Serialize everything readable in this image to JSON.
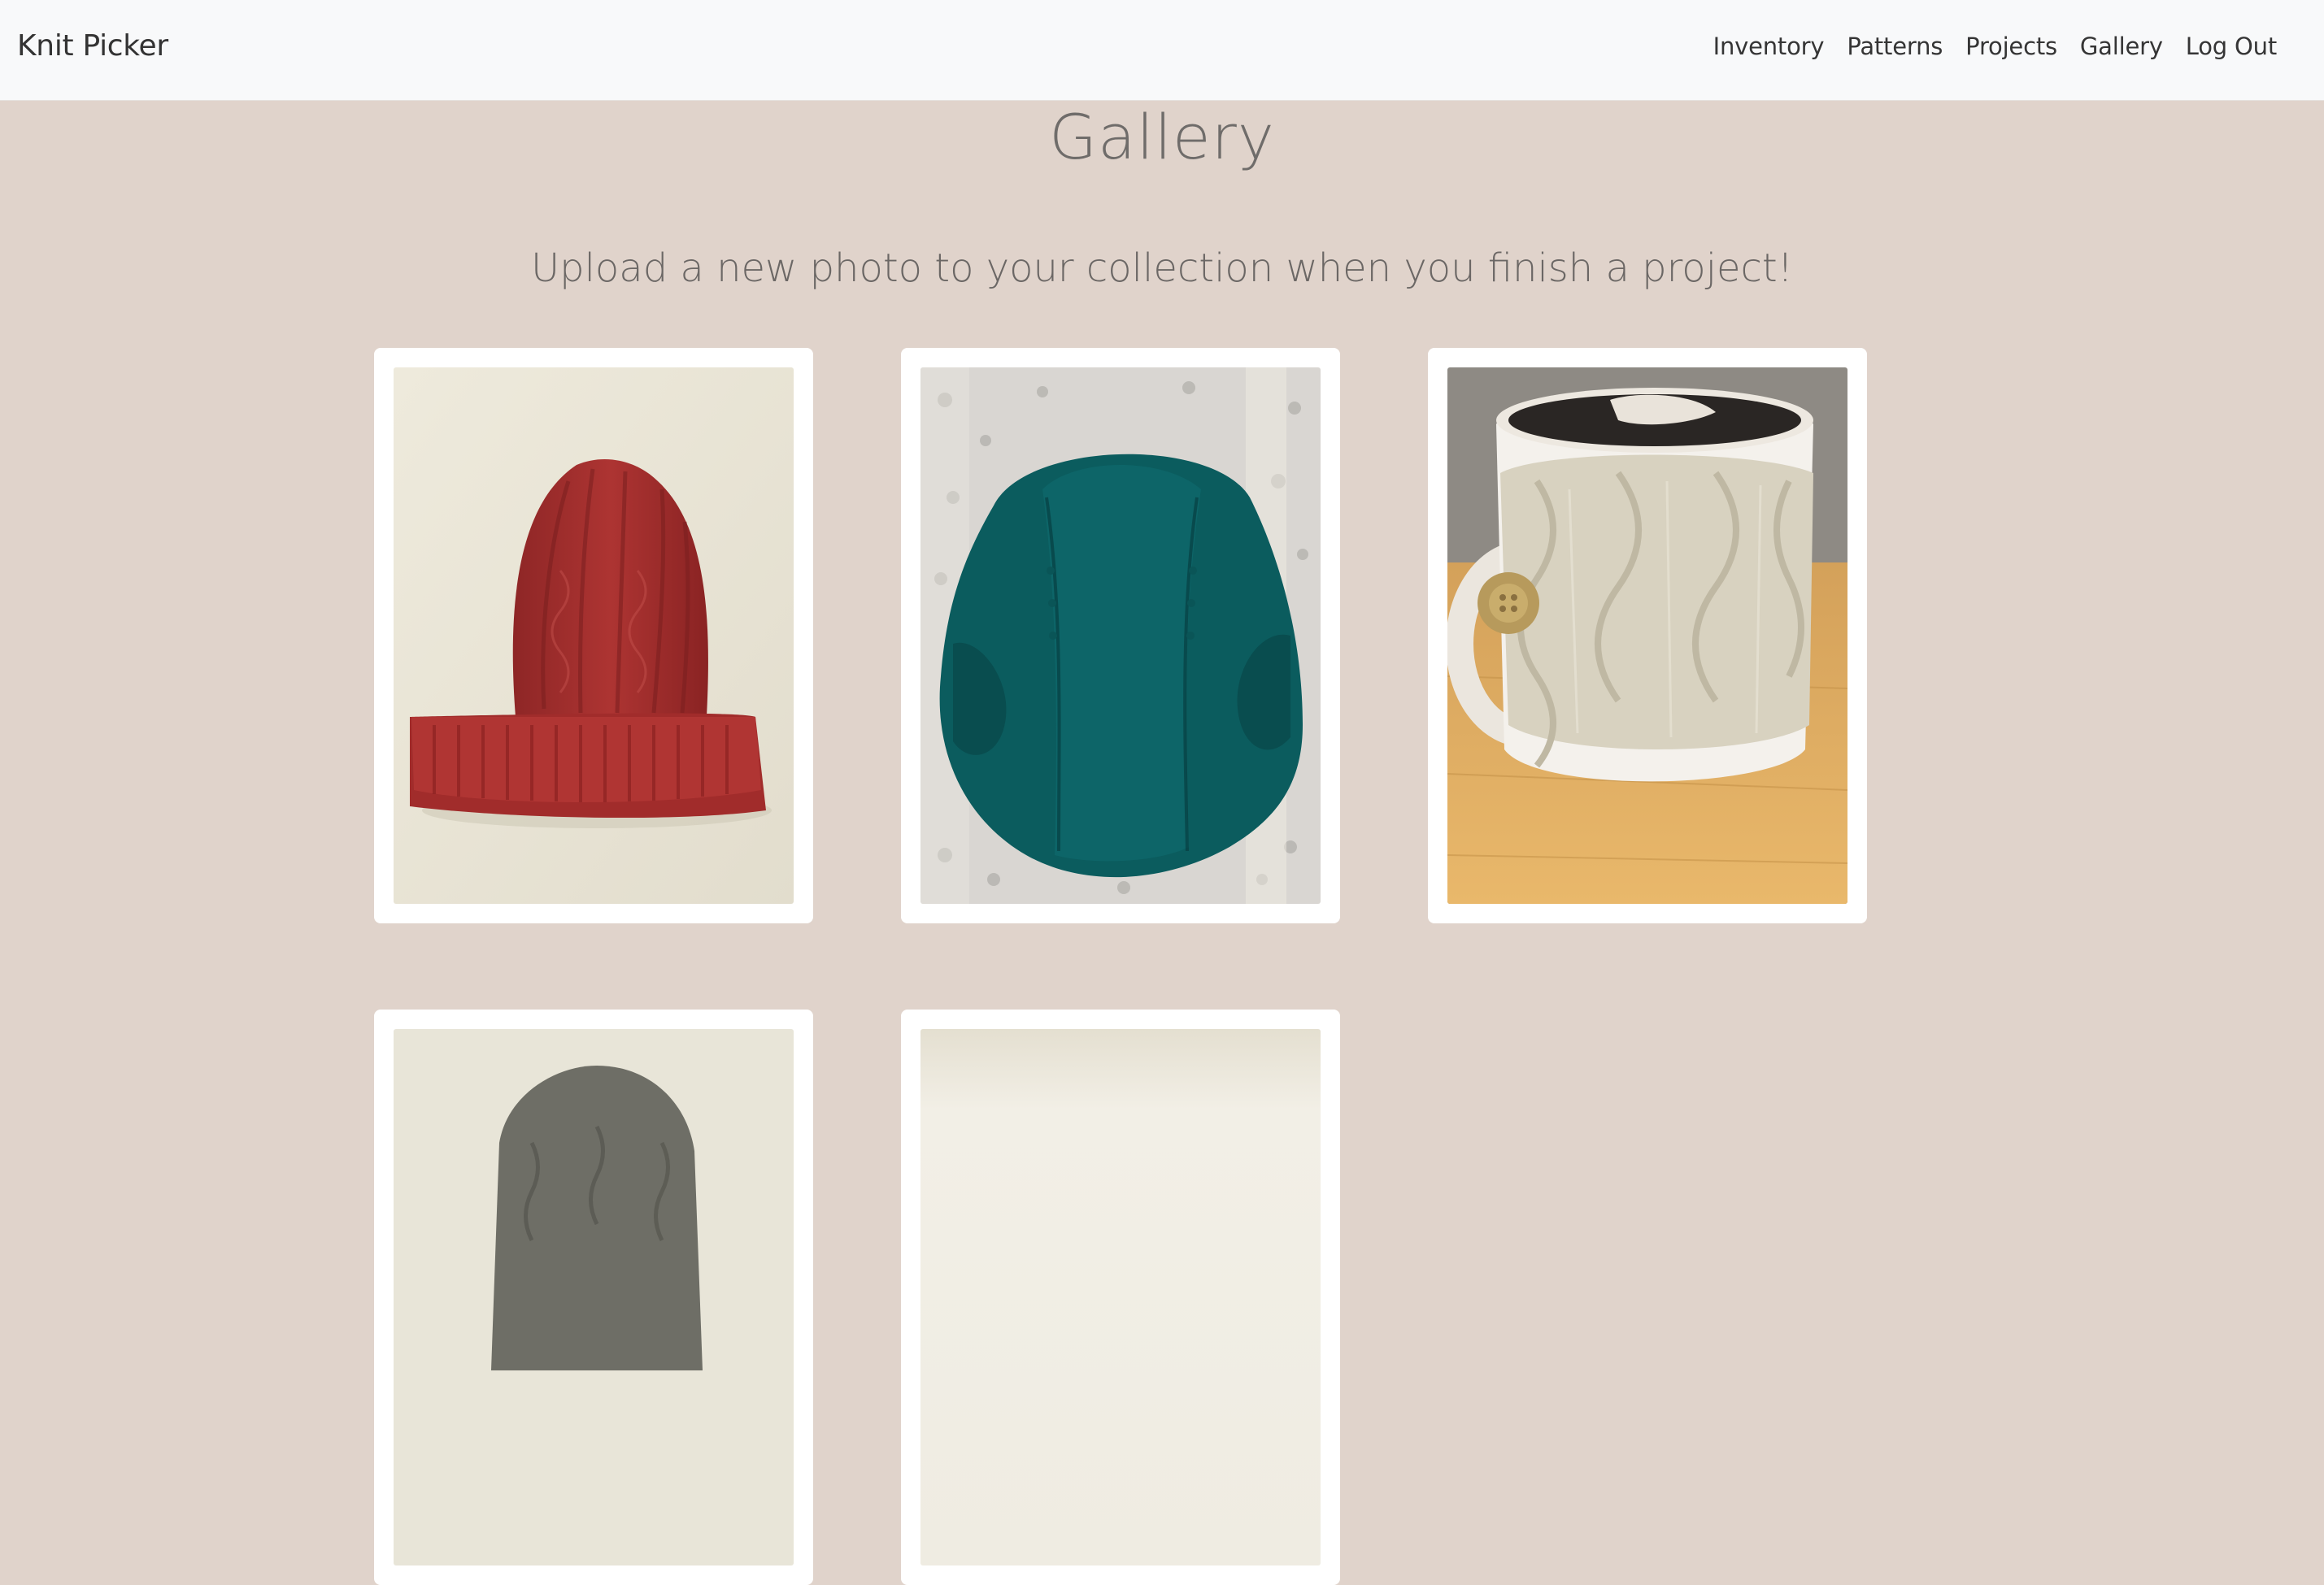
{
  "navbar": {
    "brand": "Knit Picker",
    "links": [
      "Inventory",
      "Patterns",
      "Projects",
      "Gallery",
      "Log Out"
    ]
  },
  "page": {
    "title": "Gallery",
    "subtitle": "Upload a new photo to your collection when you finish a project!"
  },
  "gallery": {
    "photos": [
      {
        "subject": "red cable-knit hat",
        "main_color": "#a8302f"
      },
      {
        "subject": "teal knit shrug",
        "main_color": "#0b5c5e"
      },
      {
        "subject": "cable-knit mug cozy with button",
        "main_color": "#d8d2c0"
      },
      {
        "subject": "gray knit hat",
        "main_color": "#6e6e66"
      },
      {
        "subject": "cream project",
        "main_color": "#efece2"
      }
    ]
  },
  "colors": {
    "background": "#e0d3cb",
    "navbar": "#f8f9fa",
    "card": "#ffffff",
    "text": "#333333"
  }
}
